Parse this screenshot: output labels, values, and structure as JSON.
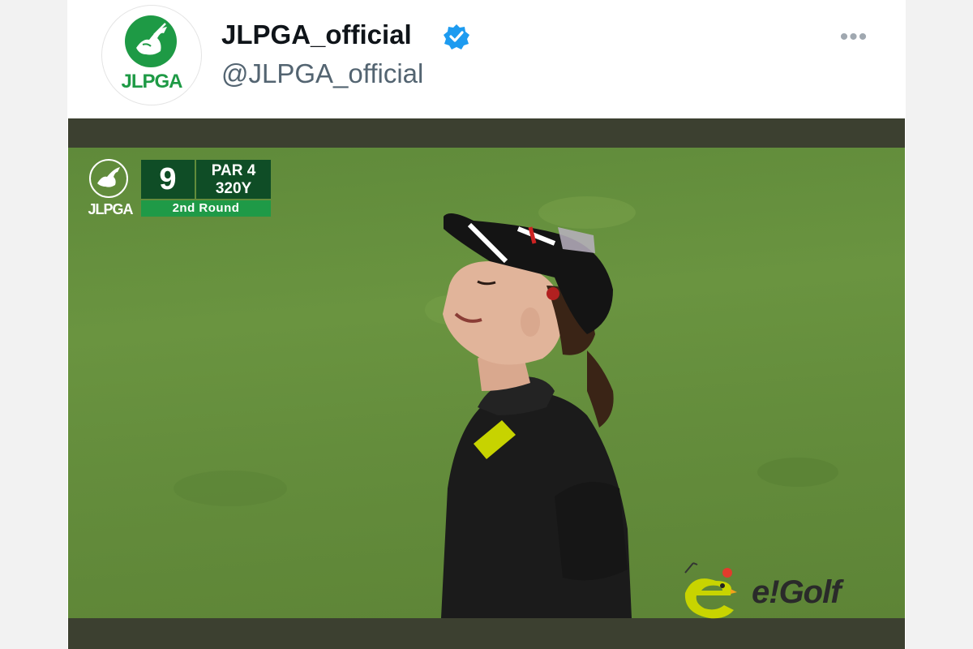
{
  "account": {
    "display_name": "JLPGA_official",
    "handle": "@JLPGA_official",
    "avatar_text": "JLPGA",
    "verified": true,
    "verified_icon": "verified-badge-icon",
    "more_icon": "more-horizontal-icon",
    "brand_color": "#1e9a45"
  },
  "media": {
    "overlay_logo_text": "JLPGA",
    "hole_number": "9",
    "par_label": "PAR 4",
    "yardage": "320Y",
    "round_label": "2nd Round",
    "score_bg_color": "#0f4d26",
    "round_bg_color": "#1f9a47"
  },
  "watermark": {
    "text": "e!Golf",
    "logo_color": "#c8d400"
  }
}
